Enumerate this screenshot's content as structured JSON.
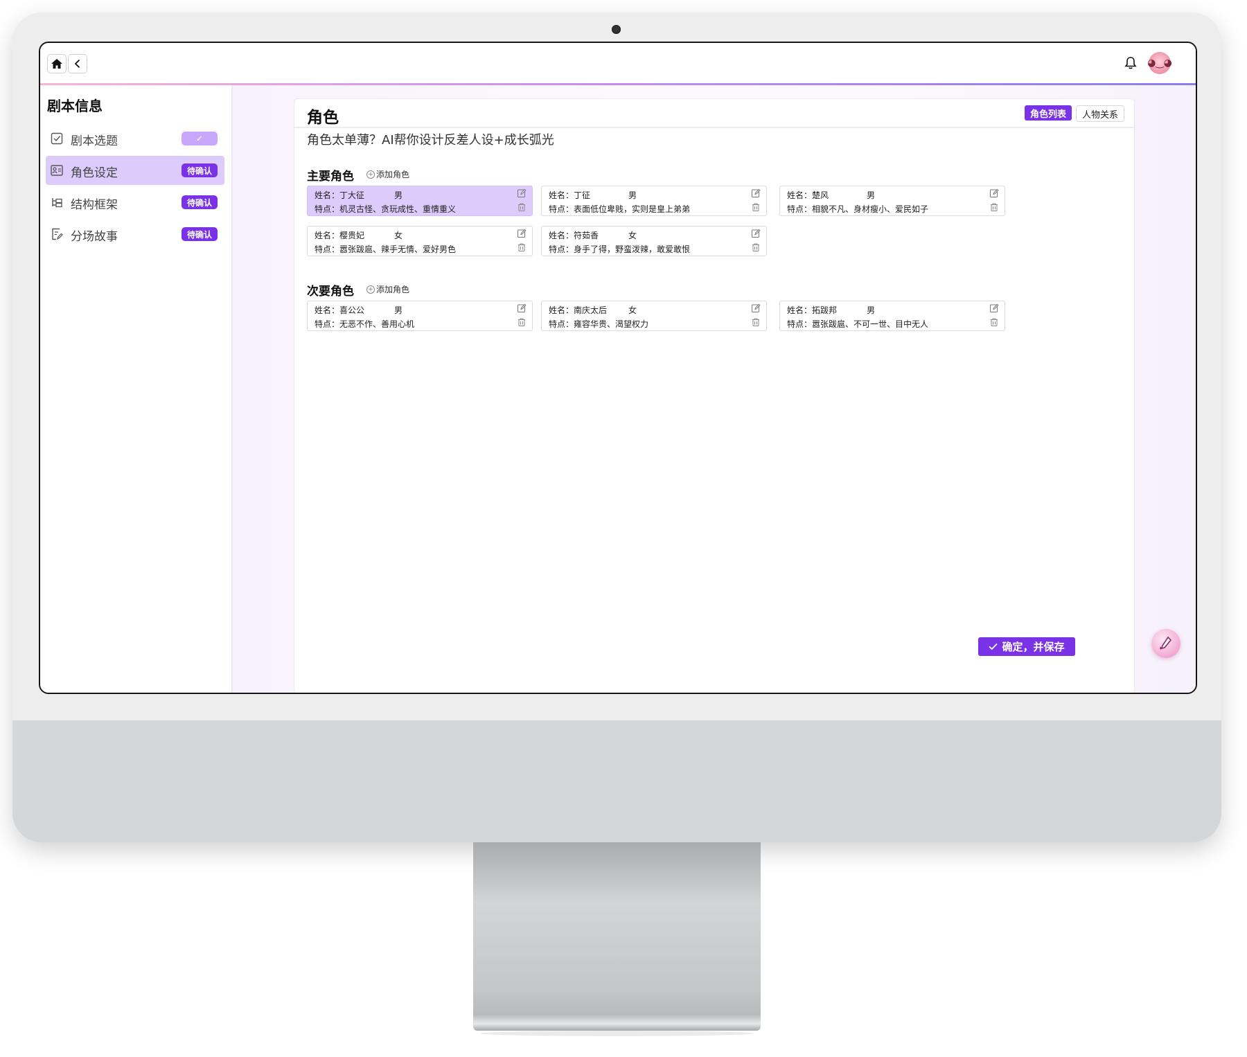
{
  "sidebar": {
    "title": "剧本信息",
    "items": [
      {
        "label": "剧本选题",
        "badge": "✓",
        "icon": "checkbox-icon"
      },
      {
        "label": "角色设定",
        "badge": "待确认",
        "icon": "people-card-icon"
      },
      {
        "label": "结构框架",
        "badge": "待确认",
        "icon": "tree-structure-icon"
      },
      {
        "label": "分场故事",
        "badge": "待确认",
        "icon": "document-edit-icon"
      }
    ]
  },
  "panel": {
    "title": "角色",
    "subtitle": "角色太单薄？AI帮你设计反差人设+成长弧光",
    "tabs": [
      {
        "label": "角色列表",
        "active": true
      },
      {
        "label": "人物关系",
        "active": false
      }
    ]
  },
  "main_roles": {
    "title": "主要角色",
    "add_label": "添加角色",
    "cards": [
      {
        "name": "姓名：丁大征",
        "gender": "男",
        "traits": "特点：机灵古怪、贪玩成性、重情重义",
        "selected": true
      },
      {
        "name": "姓名：丁征",
        "gender": "男",
        "traits": "特点：表面低位卑贱，实则是皇上弟弟",
        "selected": false
      },
      {
        "name": "姓名：楚风",
        "gender": "男",
        "traits": "特点：相貌不凡、身材瘦小、爱民如子",
        "selected": false
      },
      {
        "name": "姓名：樱贵妃",
        "gender": "女",
        "traits": "特点：嚣张跋扈、辣手无情、爱好男色",
        "selected": false
      },
      {
        "name": "姓名：符茹香",
        "gender": "女",
        "traits": "特点：身手了得，野蛮泼辣，敢爱敢恨",
        "selected": false
      }
    ]
  },
  "secondary_roles": {
    "title": "次要角色",
    "add_label": "添加角色",
    "cards": [
      {
        "name": "姓名：喜公公",
        "gender": "男",
        "traits": "特点：无恶不作、善用心机",
        "selected": false
      },
      {
        "name": "姓名：南庆太后",
        "gender": "女",
        "traits": "特点：雍容华贵、渴望权力",
        "selected": false
      },
      {
        "name": "姓名：拓跋邦",
        "gender": "男",
        "traits": "特点：嚣张跋扈、不可一世、目中无人",
        "selected": false
      }
    ]
  },
  "save_button": {
    "label": "确定，并保存"
  },
  "colors": {
    "accent": "#7a32e6",
    "selected_bg": "#dccbfb",
    "done_badge": "#c9a8fb"
  }
}
